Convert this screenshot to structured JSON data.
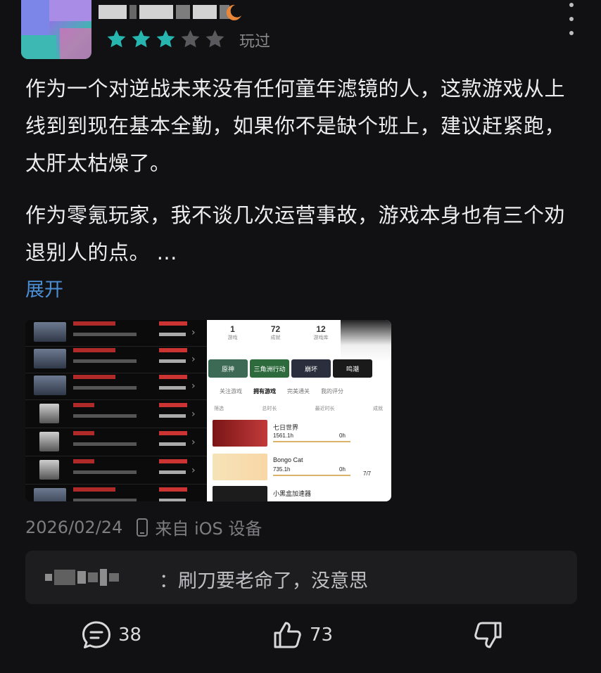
{
  "header": {
    "rating_stars": 3,
    "rating_max": 5,
    "star_color_active": "#27b5b0",
    "star_color_inactive": "#5a5a5e",
    "status": "玩过"
  },
  "review": {
    "paragraph_1": "作为一个对逆战未来没有任何童年滤镜的人，这款游戏从上线到到现在基本全勤，如果你不是缺个班上，建议赶紧跑，太肝太枯燥了。",
    "paragraph_2": "作为零氪玩家，我不谈几次运营事故，游戏本身也有三个劝退别人的点。 ...",
    "expand_label": "展开"
  },
  "screenshot_right": {
    "stats": [
      {
        "value": "1",
        "label": "游戏"
      },
      {
        "value": "72",
        "label": "成就"
      },
      {
        "value": "12",
        "label": "游戏库"
      }
    ],
    "tiles": [
      "原神",
      "三角洲行动",
      "崩坏",
      "鸣潮"
    ],
    "tabs": [
      "关注游戏",
      "拥有游戏",
      "完美通关",
      "我的评分"
    ],
    "filter": [
      "筛选",
      "总时长",
      "最近时长",
      "成就"
    ],
    "games": [
      {
        "name": "七日世界",
        "hours": "1561.1h",
        "extra": "0h"
      },
      {
        "name": "Bongo Cat",
        "hours": "735.1h",
        "extra": "0h",
        "badge": "7/7"
      },
      {
        "name": "小黑盒加速器",
        "hours": "",
        "extra": ""
      }
    ]
  },
  "meta": {
    "date": "2026/02/24",
    "source": "来自 iOS 设备"
  },
  "reply": {
    "text": "：刷刀要老命了，没意思"
  },
  "actions": {
    "comment_count": "38",
    "like_count": "73"
  }
}
